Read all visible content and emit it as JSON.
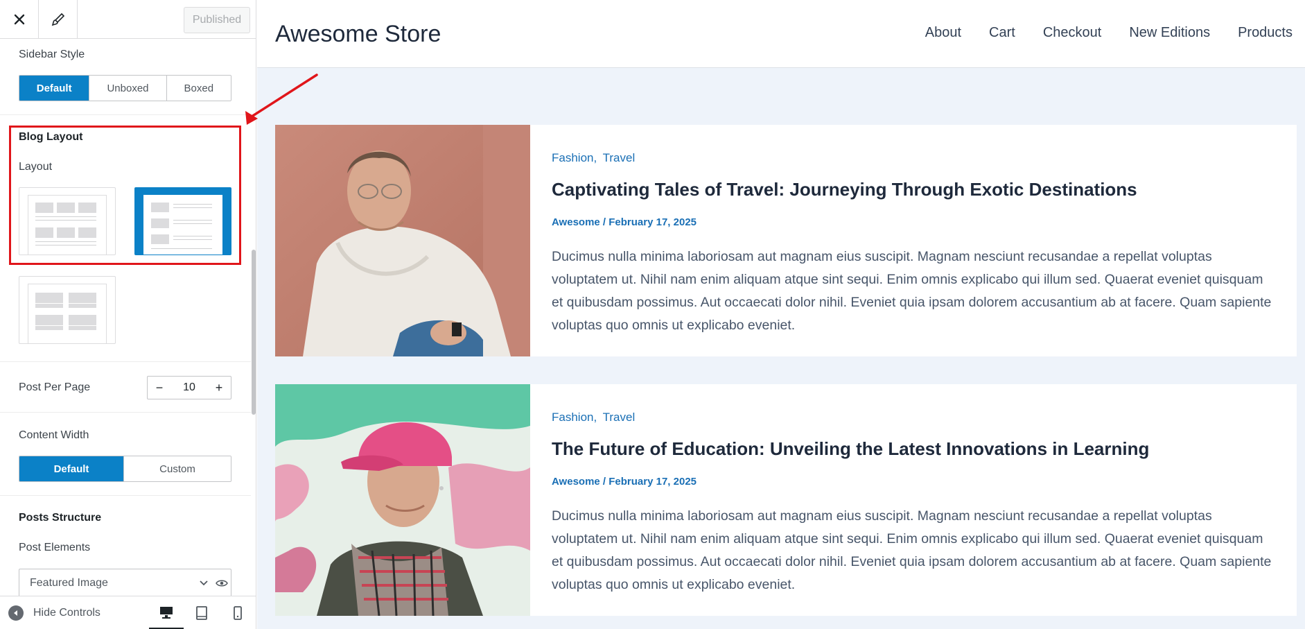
{
  "sidebar": {
    "published_label": "Published",
    "sidebar_style": {
      "label": "Sidebar Style",
      "options": [
        "Default",
        "Unboxed",
        "Boxed"
      ],
      "selected": "Default"
    },
    "blog_layout": {
      "heading": "Blog Layout",
      "layout_label": "Layout",
      "selected_index": 1
    },
    "post_per_page": {
      "label": "Post Per Page",
      "value": "10",
      "minus": "−",
      "plus": "+"
    },
    "content_width": {
      "label": "Content Width",
      "options": [
        "Default",
        "Custom"
      ],
      "selected": "Default"
    },
    "posts_structure": {
      "heading": "Posts Structure",
      "elements_label": "Post Elements",
      "first_element": "Featured Image"
    },
    "footer": {
      "hide_controls": "Hide Controls",
      "active_device": "desktop"
    }
  },
  "site": {
    "title": "Awesome Store",
    "nav": [
      "About",
      "Cart",
      "Checkout",
      "New Editions",
      "Products"
    ]
  },
  "posts": [
    {
      "categories": [
        "Fashion,",
        "Travel"
      ],
      "title": "Captivating Tales of Travel: Journeying Through Exotic Destinations",
      "meta": "Awesome / February 17, 2025",
      "excerpt": "Ducimus nulla minima laboriosam aut magnam eius suscipit. Magnam nesciunt recusandae a repellat voluptas voluptatem ut. Nihil nam enim aliquam atque sint sequi. Enim omnis explicabo qui illum sed. Quaerat eveniet quisquam et quibusdam possimus. Aut occaecati dolor nihil. Eveniet quia ipsam dolorem accusantium ab at facere. Quam sapiente voluptas quo omnis ut explicabo eveniet."
    },
    {
      "categories": [
        "Fashion,",
        "Travel"
      ],
      "title": "The Future of Education: Unveiling the Latest Innovations in Learning",
      "meta": "Awesome / February 17, 2025",
      "excerpt": "Ducimus nulla minima laboriosam aut magnam eius suscipit. Magnam nesciunt recusandae a repellat voluptas voluptatem ut. Nihil nam enim aliquam atque sint sequi. Enim omnis explicabo qui illum sed. Quaerat eveniet quisquam et quibusdam possimus. Aut occaecati dolor nihil. Eveniet quia ipsam dolorem accusantium ab at facere. Quam sapiente voluptas quo omnis ut explicabo eveniet."
    }
  ],
  "colors": {
    "accent": "#0b81c7",
    "highlight_box": "#e0151a",
    "link": "#1a6fb5",
    "preview_bg": "#eef3fa"
  }
}
